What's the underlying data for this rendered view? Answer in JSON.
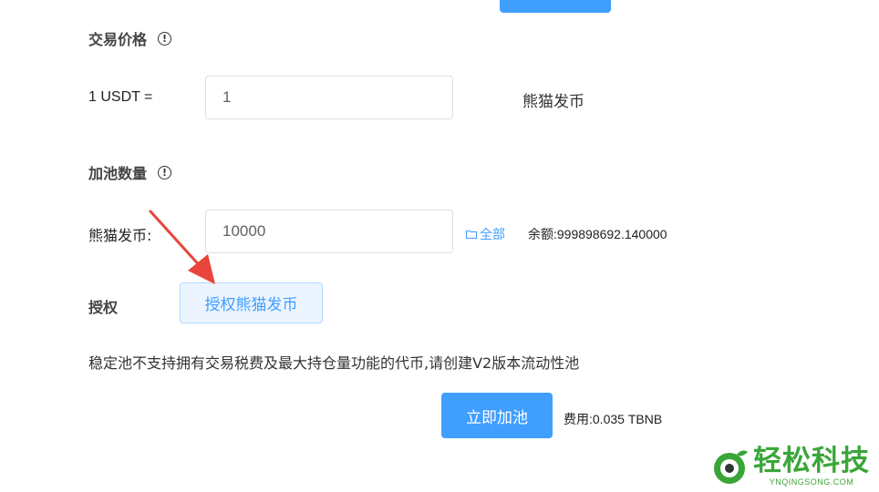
{
  "price_section": {
    "title": "交易价格",
    "rate_label": "1 USDT =",
    "rate_value": "1",
    "unit": "熊猫发币"
  },
  "amount_section": {
    "title": "加池数量",
    "token_label": "熊猫发币:",
    "amount_value": "10000",
    "all_label": "全部",
    "balance_text": "余额:999898692.140000"
  },
  "auth_section": {
    "title": "授权",
    "button_label": "授权熊猫发币"
  },
  "notice": "稳定池不支持拥有交易税费及最大持仓量功能的代币,请创建V2版本流动性池",
  "submit": {
    "button_label": "立即加池",
    "fee_text": "费用:0.035 TBNB"
  },
  "watermark": {
    "title": "轻松科技",
    "subtitle": "YNQINGSONG.COM"
  },
  "colors": {
    "primary": "#409eff",
    "auth_bg": "#ecf5ff",
    "annotation_arrow": "#e8453c",
    "watermark": "#3aa639"
  }
}
